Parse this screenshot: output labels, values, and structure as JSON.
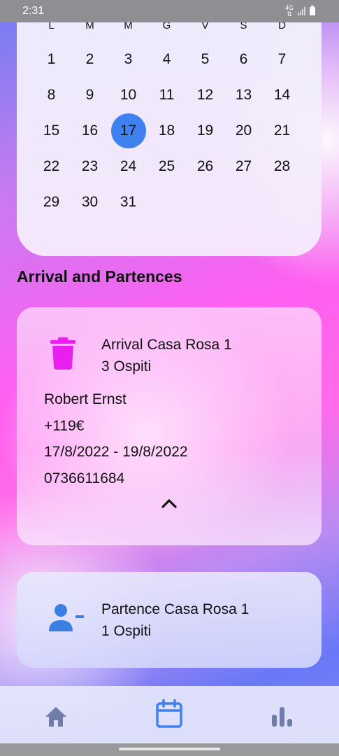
{
  "status_bar": {
    "time": "2:31",
    "network": "4G"
  },
  "calendar": {
    "weekdays": [
      "L",
      "M",
      "M",
      "G",
      "V",
      "S",
      "D"
    ],
    "days": [
      "1",
      "2",
      "3",
      "4",
      "5",
      "6",
      "7",
      "8",
      "9",
      "10",
      "11",
      "12",
      "13",
      "14",
      "15",
      "16",
      "17",
      "18",
      "19",
      "20",
      "21",
      "22",
      "23",
      "24",
      "25",
      "26",
      "27",
      "28",
      "29",
      "30",
      "31"
    ],
    "selected_day": "17"
  },
  "section_title": "Arrival and Partences",
  "arrival_card": {
    "title": "Arrival Casa Rosa 1",
    "guests": "3 Ospiti",
    "guest_name": "Robert Ernst",
    "price": "+119€",
    "dates": "17/8/2022 - 19/8/2022",
    "phone": "0736611684",
    "icon": "trash-icon",
    "icon_color": "#e81ff0"
  },
  "departure_card": {
    "title": "Partence Casa Rosa 1",
    "guests": "1 Ospiti",
    "icon": "person-remove-icon",
    "icon_color": "#3b7fe0"
  },
  "bottom_nav": {
    "items": [
      "home-icon",
      "calendar-icon",
      "stats-icon"
    ],
    "active": "calendar-icon",
    "active_color": "#3f82ef",
    "inactive_color": "#6f7ca8"
  }
}
